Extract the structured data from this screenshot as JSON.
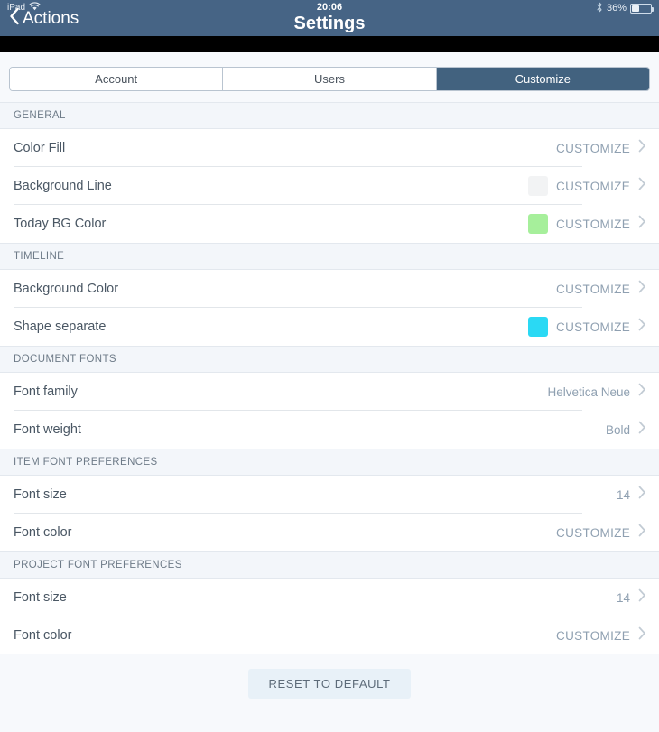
{
  "status_bar": {
    "device_label": "iPad",
    "wifi_icon": "wifi-icon",
    "bluetooth_icon": "bluetooth-icon",
    "battery_percent": "36%",
    "battery_icon": "battery-icon",
    "battery_level": 36
  },
  "navbar": {
    "back_label": "Actions",
    "back_icon": "chevron-left-icon",
    "time": "20:06",
    "title": "Settings",
    "background_color": "#466485"
  },
  "segmented_control": {
    "tabs": [
      {
        "label": "Account",
        "selected": false
      },
      {
        "label": "Users",
        "selected": false
      },
      {
        "label": "Customize",
        "selected": true
      }
    ],
    "selected_color": "#42627F"
  },
  "sections": [
    {
      "header": "GENERAL",
      "rows": [
        {
          "label": "Color Fill",
          "value": "CUSTOMIZE",
          "swatch": null
        },
        {
          "label": "Background Line",
          "value": "CUSTOMIZE",
          "swatch": "#F2F3F4"
        },
        {
          "label": "Today BG Color",
          "value": "CUSTOMIZE",
          "swatch": "#A6EF9B"
        }
      ]
    },
    {
      "header": "TIMELINE",
      "rows": [
        {
          "label": "Background Color",
          "value": "CUSTOMIZE",
          "swatch": null
        },
        {
          "label": "Shape separate",
          "value": "CUSTOMIZE",
          "swatch": "#2AD9F4"
        }
      ]
    },
    {
      "header": "DOCUMENT FONTS",
      "rows": [
        {
          "label": "Font family",
          "value": "Helvetica Neue",
          "swatch": null
        },
        {
          "label": "Font weight",
          "value": "Bold",
          "swatch": null
        }
      ]
    },
    {
      "header": "ITEM FONT PREFERENCES",
      "rows": [
        {
          "label": "Font size",
          "value": "14",
          "swatch": null
        },
        {
          "label": "Font color",
          "value": "CUSTOMIZE",
          "swatch": null
        }
      ]
    },
    {
      "header": "PROJECT FONT PREFERENCES",
      "rows": [
        {
          "label": "Font size",
          "value": "14",
          "swatch": null
        },
        {
          "label": "Font color",
          "value": "CUSTOMIZE",
          "swatch": null
        }
      ]
    }
  ],
  "footer": {
    "reset_label": "RESET TO DEFAULT"
  },
  "icons": {
    "disclosure": "chevron-right-icon"
  }
}
